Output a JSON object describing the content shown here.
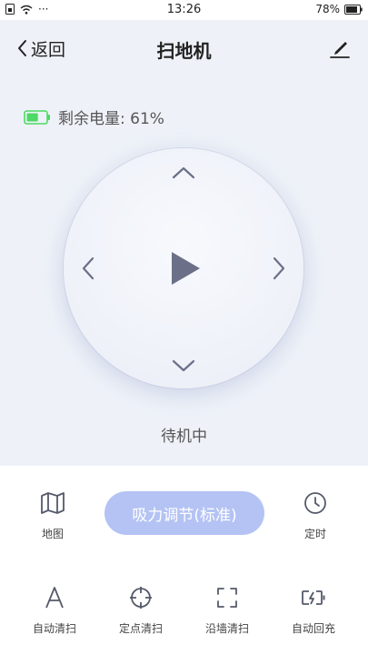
{
  "status_bar": {
    "time": "13:26",
    "battery": "78%",
    "dots": "···"
  },
  "header": {
    "back_label": "返回",
    "title": "扫地机"
  },
  "battery": {
    "label": "剩余电量: 61%",
    "level_percent": 61,
    "color": "#4cd964"
  },
  "control": {
    "state": "待机中"
  },
  "row1": {
    "map_label": "地图",
    "suction_label": "吸力调节(标准)",
    "timer_label": "定时"
  },
  "row2": {
    "items": [
      {
        "label": "自动清扫",
        "icon": "letter-a-icon"
      },
      {
        "label": "定点清扫",
        "icon": "crosshair-icon"
      },
      {
        "label": "沿墙清扫",
        "icon": "corners-icon"
      },
      {
        "label": "自动回充",
        "icon": "charging-icon"
      }
    ]
  },
  "colors": {
    "accent": "#b4c3f4",
    "top_bg": "#eef2f8",
    "icon_gray": "#555a6a"
  }
}
